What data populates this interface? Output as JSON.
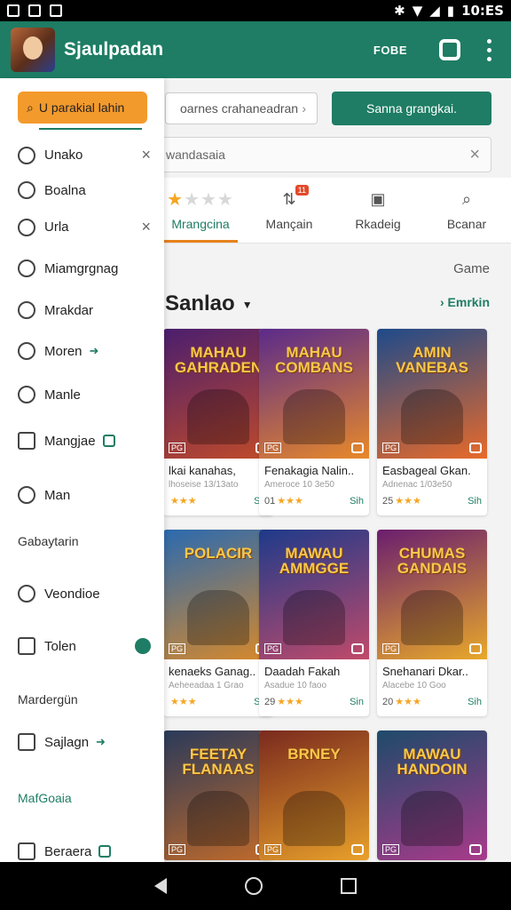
{
  "status_bar": {
    "time": "10:ES"
  },
  "app_bar": {
    "title": "Sjaulpadan",
    "action_label": "FOBE"
  },
  "toolbar": {
    "filter_label": "oarnes crahaneadran",
    "primary_button": "Sanna grangkai."
  },
  "search": {
    "value": "wandasaia"
  },
  "tabs": [
    {
      "label": "Mrangcina",
      "icon": "star-rating-icon",
      "active": true
    },
    {
      "label": "Mançain",
      "icon": "players-icon",
      "badge": "11"
    },
    {
      "label": "Rkadeig",
      "icon": "box-icon"
    },
    {
      "label": "Bcanar",
      "icon": "search-icon"
    }
  ],
  "section": {
    "meta": "Game",
    "title": "Sanlao",
    "see_more": "Emrkin"
  },
  "games": [
    {
      "art_title": "MAHAU\nGAHRADEN",
      "name": "lkai kanahas,",
      "sub": "lhoseise 13/13ato",
      "score": "",
      "price": "Sih",
      "c1": "#4b1e6e",
      "c2": "#c04a2a"
    },
    {
      "art_title": "MAHAU\nCOMBANS",
      "name": "Fenakagia Nalin..",
      "sub": "Ameroce 10 3e50",
      "score": "01",
      "price": "Sih",
      "c1": "#5a2a8a",
      "c2": "#e8892a"
    },
    {
      "art_title": "AMIN\nVANEBAS",
      "name": "Easbageal Gkan.",
      "sub": "Adnenac 1/03e50",
      "score": "25",
      "price": "Sih",
      "c1": "#1e4a8a",
      "c2": "#e86a2a"
    },
    {
      "art_title": "POLACIR",
      "name": "kenaeks Ganag..",
      "sub": "Aeheeadaa 1 Grao",
      "score": "",
      "price": "Sih",
      "c1": "#2a6ab0",
      "c2": "#d8892a"
    },
    {
      "art_title": "MAWAU\nAMMGGE",
      "name": "Daadah Fakah",
      "sub": "Asadue 10 faoo",
      "score": "29",
      "price": "Sin",
      "c1": "#1e3a8a",
      "c2": "#c04a6a"
    },
    {
      "art_title": "CHUMAS\nGANDAIS",
      "name": "Snehanari Dkar..",
      "sub": "Alacebe 10 Goo",
      "score": "20",
      "price": "Sih",
      "c1": "#6a1e6e",
      "c2": "#e8a82a"
    },
    {
      "art_title": "FEETAY\nFLANAAS",
      "name": "",
      "sub": "",
      "score": "",
      "price": "",
      "c1": "#2a3a5a",
      "c2": "#c06a2a"
    },
    {
      "art_title": "BRNEY",
      "name": "",
      "sub": "",
      "score": "",
      "price": "",
      "c1": "#7a2a1e",
      "c2": "#e8a02a"
    },
    {
      "art_title": "MAWAU\nHANDOIN",
      "name": "",
      "sub": "",
      "score": "",
      "price": "",
      "c1": "#1e4a6a",
      "c2": "#a83a8a"
    }
  ],
  "drawer": {
    "pill_label": "U parakial lahin",
    "items": [
      {
        "label": "Unako",
        "icon": "refresh-icon",
        "trail": "close"
      },
      {
        "label": "Boalna",
        "icon": "camera-icon"
      },
      {
        "label": "Urla",
        "icon": "bell-icon",
        "trail": "close"
      },
      {
        "label": "Miamgrgnag",
        "icon": "search-icon"
      },
      {
        "label": "Mrakdar",
        "icon": "gear-icon"
      },
      {
        "label": "Moren",
        "icon": "chat-icon",
        "trail": "arrow"
      },
      {
        "label": "Manle",
        "icon": "person-icon"
      },
      {
        "label": "Mangjae",
        "icon": "frame-icon",
        "trail": "green-box"
      },
      {
        "label": "Man",
        "icon": "people-icon"
      }
    ],
    "heading1": "Gabaytarin",
    "items2": [
      {
        "label": "Veondioe",
        "icon": "clock-icon"
      },
      {
        "label": "Tolen",
        "icon": "card-icon",
        "trail": "green-dot"
      }
    ],
    "heading2": "Mardergün",
    "items3": [
      {
        "label": "Sajlagn",
        "icon": "ticket-icon",
        "trail": "arrow"
      }
    ],
    "heading3": "MafGoaia",
    "items4": [
      {
        "label": "Beraera",
        "icon": "grid-icon",
        "trail": "green-box"
      }
    ]
  },
  "colors": {
    "brand": "#1e7d64",
    "accent": "#f39a2c",
    "star": "#f5a623"
  }
}
